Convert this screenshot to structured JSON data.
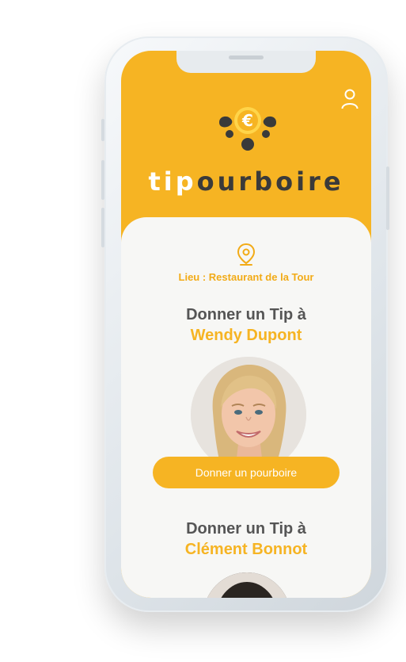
{
  "app": {
    "brand_tip": "tip",
    "brand_rest": "ourboire",
    "logo_symbol": "€"
  },
  "venue": {
    "label": "Lieu : Restaurant de la Tour"
  },
  "staff": [
    {
      "title": "Donner un Tip  à",
      "name": "Wendy Dupont",
      "button_label": "Donner un pourboire"
    },
    {
      "title": "Donner un Tip  à",
      "name": "Clément Bonnot"
    }
  ],
  "icons": {
    "profile": "user-icon",
    "location": "map-pin-icon",
    "logo": "coin-logo-icon"
  },
  "colors": {
    "brand_yellow": "#f6b423",
    "accent_orange": "#f2ab17",
    "dark_text": "#3a3a3a",
    "card_bg": "#f7f7f5"
  }
}
